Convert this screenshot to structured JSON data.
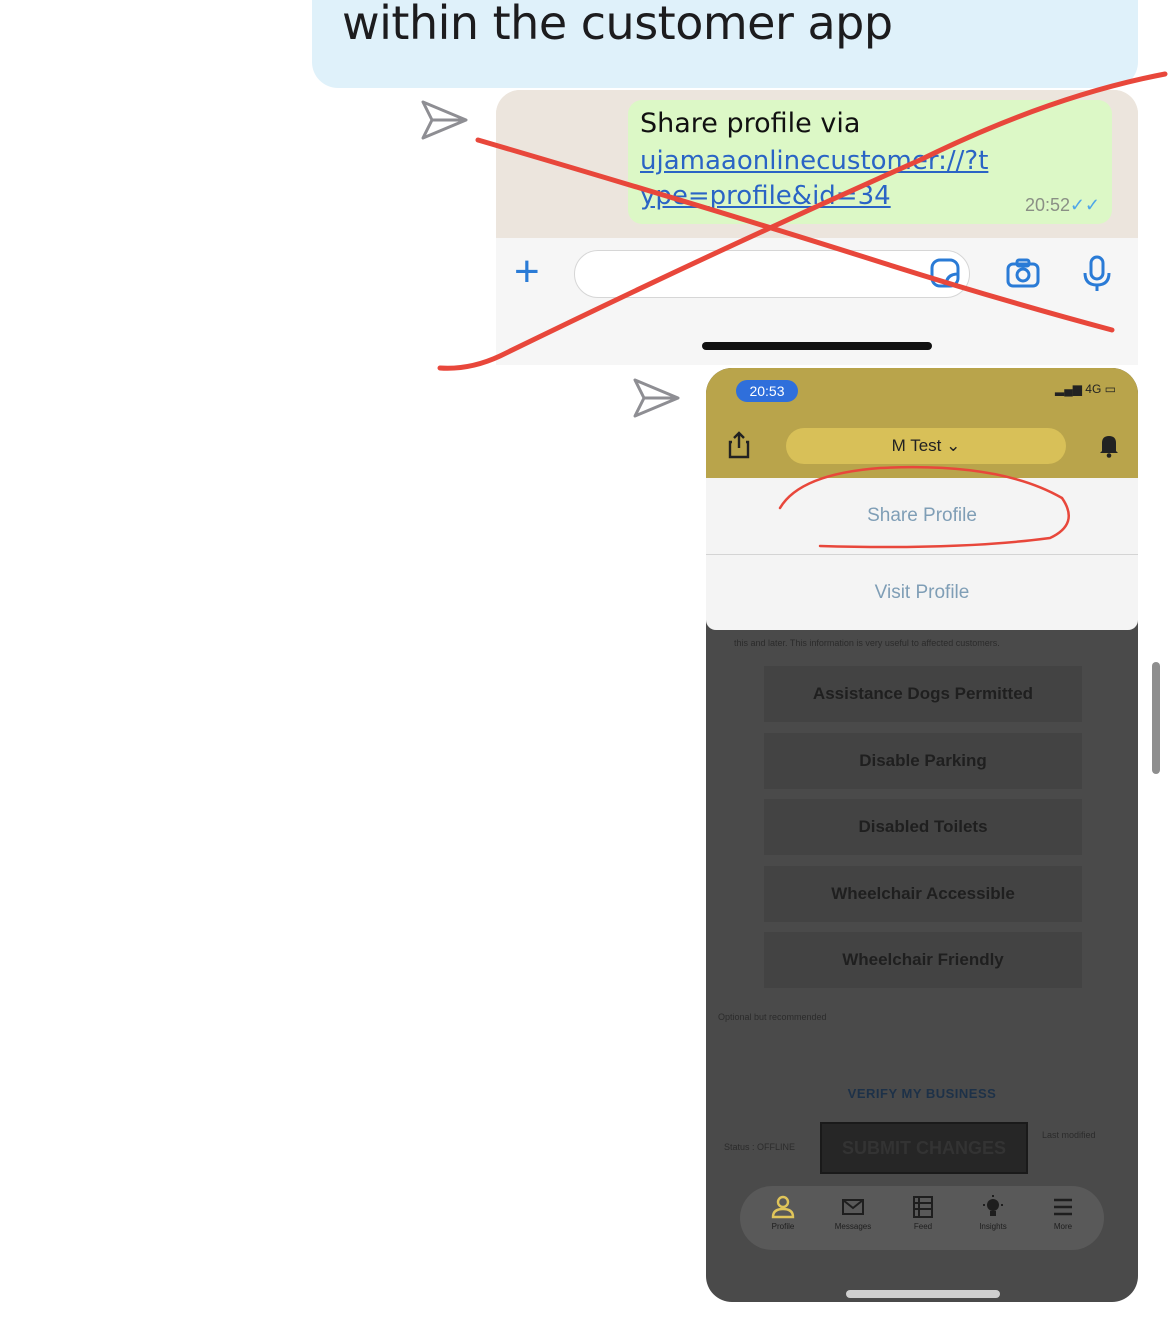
{
  "message": {
    "text": "within the customer app"
  },
  "whatsapp_screenshot": {
    "message_line1": "Share profile via",
    "link_text": "ujamaaonlinecustomer://?type=profile&id=34",
    "time": "20:52",
    "ticks": "✓✓",
    "icons": [
      "plus-icon",
      "sticker-icon",
      "camera-icon",
      "microphone-icon"
    ]
  },
  "app_screenshot": {
    "status_time": "20:53",
    "status_right": "4G",
    "profile_name": "M Test ⌄",
    "menu": {
      "share_profile": "Share Profile",
      "visit_profile": "Visit Profile"
    },
    "dim_caption": "this and later. This information is very useful to affected customers.",
    "options": [
      "Assistance Dogs Permitted",
      "Disable Parking",
      "Disabled Toilets",
      "Wheelchair Accessible",
      "Wheelchair Friendly"
    ],
    "optional_note": "Optional but recommended",
    "verify": "VERIFY MY BUSINESS",
    "status_label": "Status : OFFLINE",
    "submit": "SUBMIT CHANGES",
    "last_modified": "Last modified",
    "tabs": [
      "Profile",
      "Messages",
      "Feed",
      "Insights",
      "More"
    ]
  },
  "colors": {
    "annotation_red": "#e8473b",
    "app_header": "#b9a44b",
    "bubble_blue": "#dff1fa"
  }
}
